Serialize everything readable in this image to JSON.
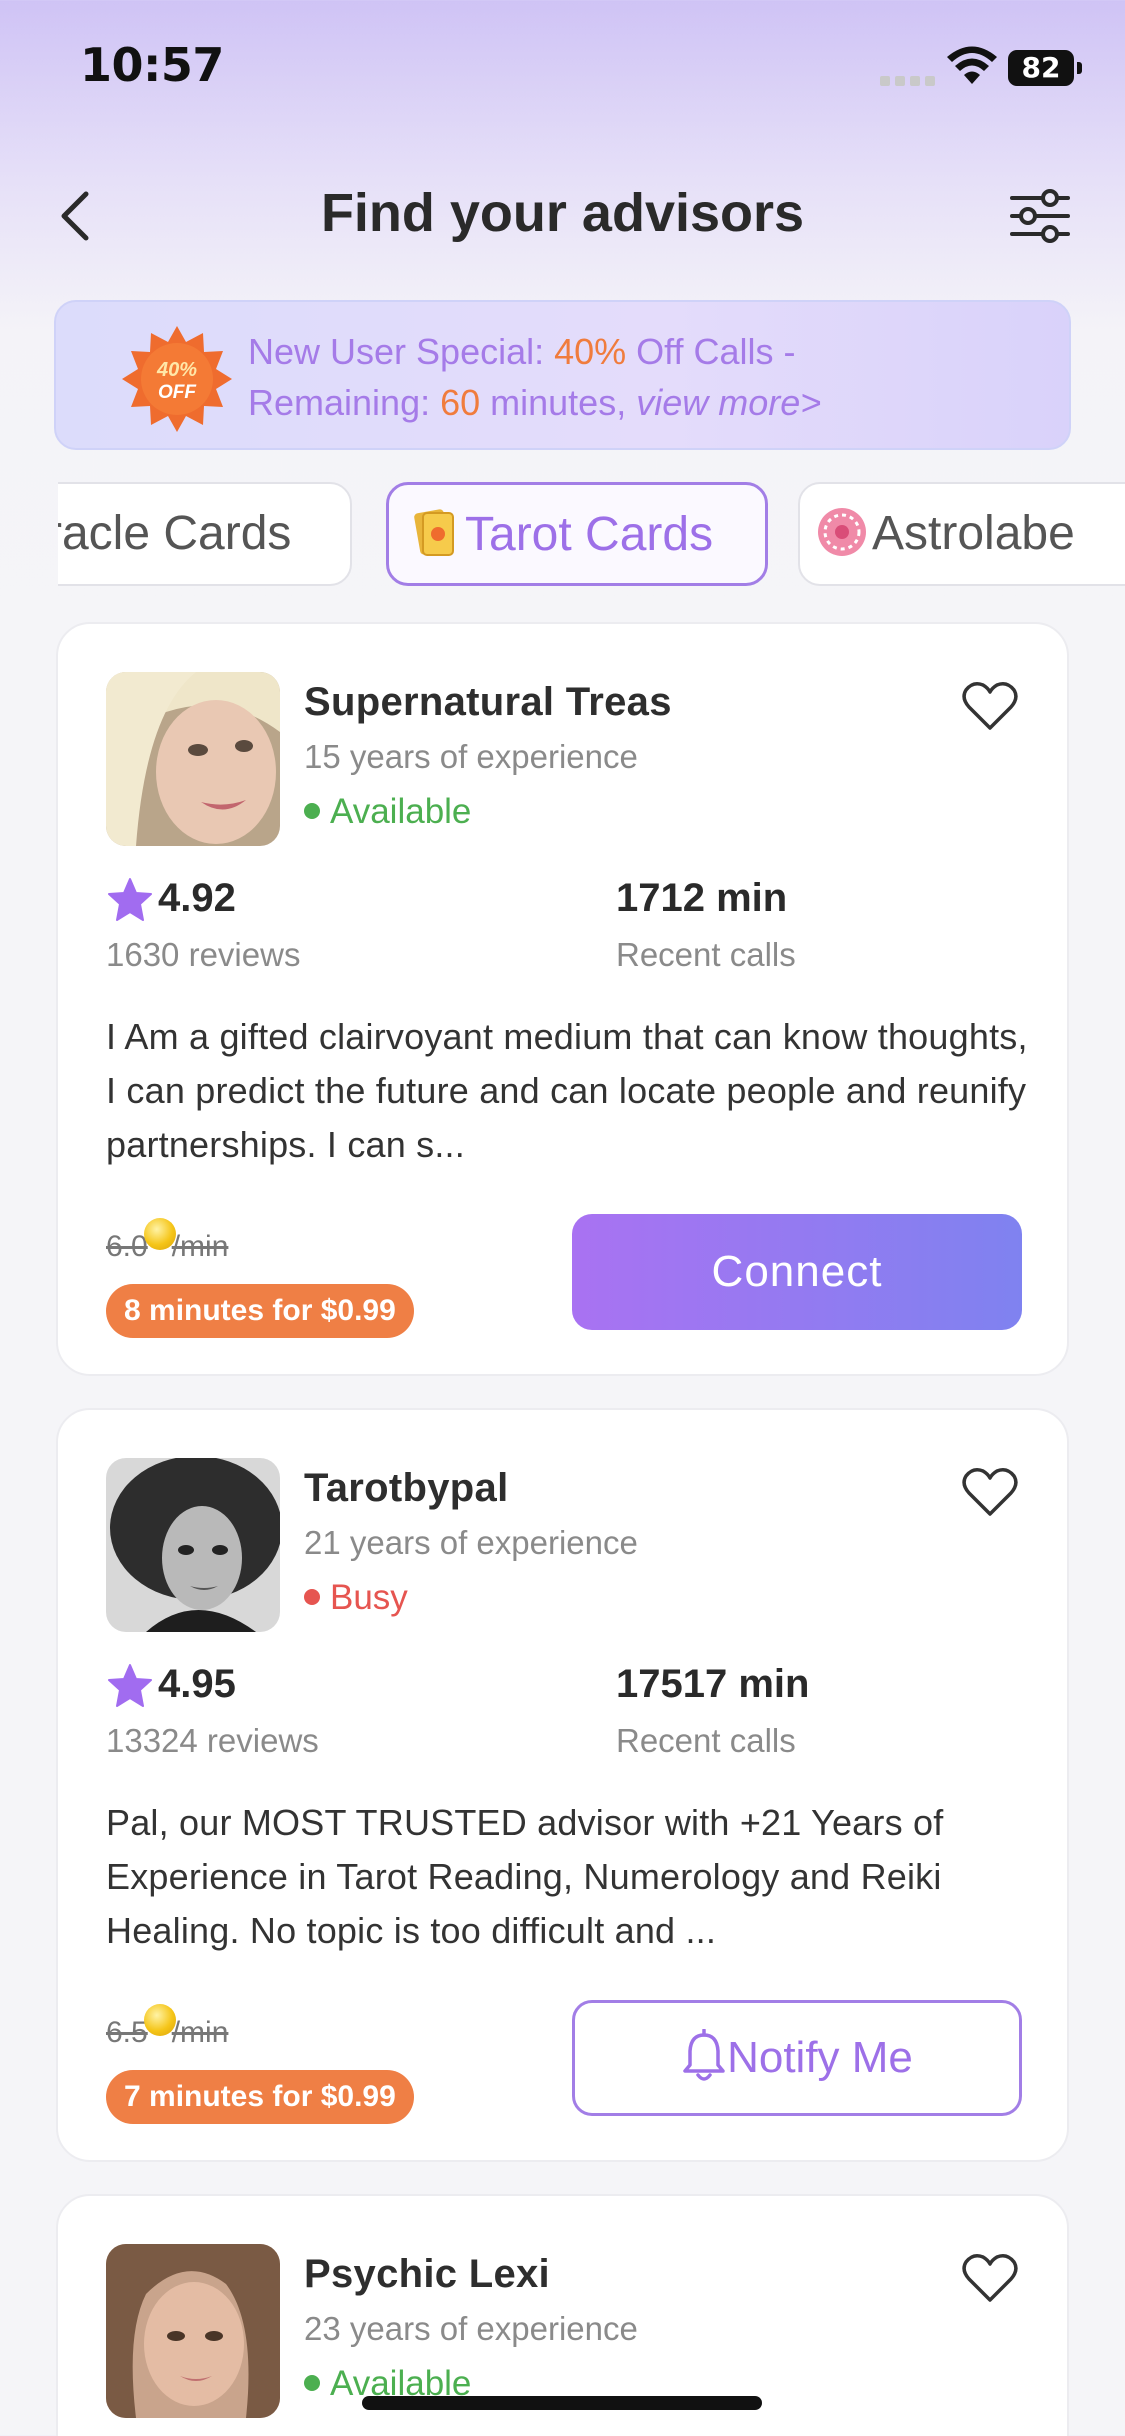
{
  "status_bar": {
    "time": "10:57",
    "battery": "82"
  },
  "header": {
    "title": "Find your advisors"
  },
  "promo": {
    "badge_top": "40%",
    "badge_bottom": "OFF",
    "line1_prefix": "New User Special: ",
    "line1_highlight": "40%",
    "line1_suffix": " Off Calls -",
    "line2_prefix": "Remaining: ",
    "line2_highlight": "60",
    "line2_suffix": " minutes, ",
    "view_more": "view more>"
  },
  "tabs": [
    {
      "label": "racle Cards",
      "active": false
    },
    {
      "label": "Tarot Cards",
      "active": true
    },
    {
      "label": "Astrolabe",
      "active": false
    }
  ],
  "advisors": [
    {
      "name": "Supernatural Treas",
      "experience": "15 years of experience",
      "status": "Available",
      "rating": "4.92",
      "reviews": "1630 reviews",
      "calls": "1712 min",
      "calls_label": "Recent calls",
      "description": "I Am a gifted clairvoyant medium that can know thoughts, I can predict the future and can locate people and reunify partnerships. I can s...",
      "old_price": "6.0",
      "per_min": "/min",
      "deal": "8 minutes for $0.99",
      "action": "Connect"
    },
    {
      "name": "Tarotbypal",
      "experience": "21 years of experience",
      "status": "Busy",
      "rating": "4.95",
      "reviews": "13324 reviews",
      "calls": "17517 min",
      "calls_label": "Recent calls",
      "description": "Pal, our MOST TRUSTED advisor with +21 Years of Experience in Tarot Reading, Numerology and Reiki Healing. No topic is too difficult and ...",
      "old_price": "6.5",
      "per_min": "/min",
      "deal": "7 minutes for $0.99",
      "action": "Notify Me"
    },
    {
      "name": "Psychic Lexi",
      "experience": "23 years of experience",
      "status": "Available"
    }
  ],
  "colors": {
    "accent": "#9d70e8",
    "orange": "#ef7f45",
    "available": "#4caf50",
    "busy": "#e65550"
  }
}
